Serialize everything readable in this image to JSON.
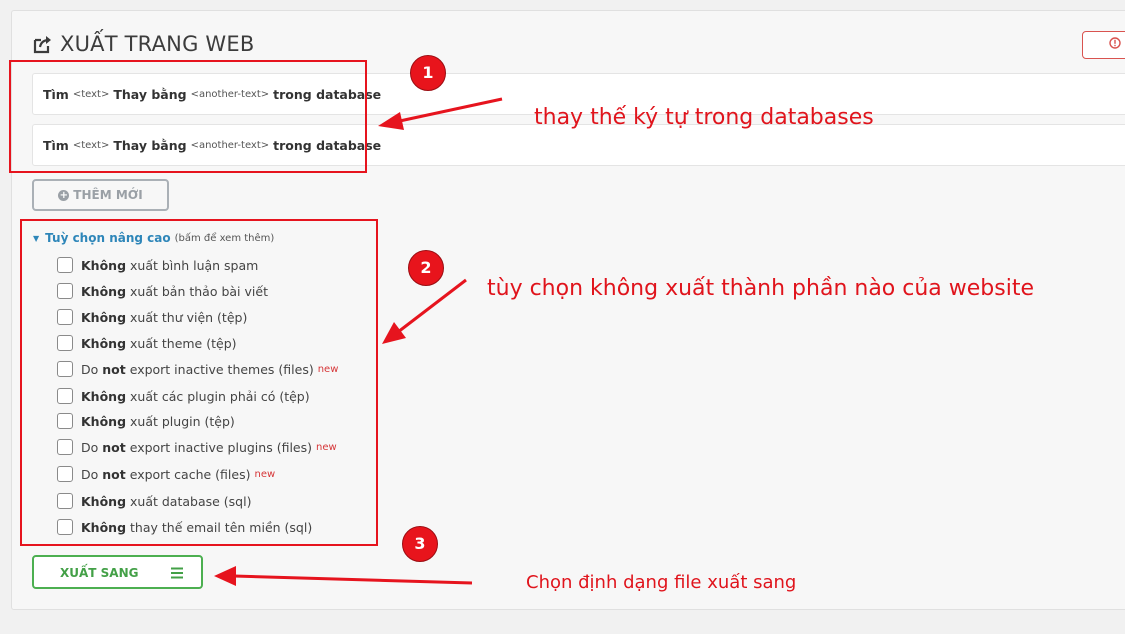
{
  "header": {
    "title": "XUẤT TRANG WEB",
    "help_icon": "info-circle-icon",
    "export_icon": "share-square-icon"
  },
  "replace_rows": [
    {
      "find": "Tìm",
      "text_placeholder": "<text>",
      "replace": "Thay bằng",
      "another_placeholder": "<another-text>",
      "suffix": "trong database"
    },
    {
      "find": "Tìm",
      "text_placeholder": "<text>",
      "replace": "Thay bằng",
      "another_placeholder": "<another-text>",
      "suffix": "trong database"
    }
  ],
  "add_button": {
    "label": "THÊM MỚI",
    "icon": "plus-circle-icon"
  },
  "advanced": {
    "label": "Tuỳ chọn nâng cao",
    "hint": "(bấm để xem thêm)",
    "options": [
      {
        "bold": "Không",
        "rest": "xuất bình luận spam",
        "new": ""
      },
      {
        "bold": "Không",
        "rest": "xuất bản thảo bài viết",
        "new": ""
      },
      {
        "bold": "Không",
        "rest": "xuất thư viện (tệp)",
        "new": ""
      },
      {
        "bold": "Không",
        "rest": "xuất theme (tệp)",
        "new": ""
      },
      {
        "pre": "Do",
        "bold": "not",
        "rest": "export inactive themes (files)",
        "new": "new"
      },
      {
        "bold": "Không",
        "rest": "xuất các plugin phải có (tệp)",
        "new": ""
      },
      {
        "bold": "Không",
        "rest": "xuất plugin (tệp)",
        "new": ""
      },
      {
        "pre": "Do",
        "bold": "not",
        "rest": "export inactive plugins (files)",
        "new": "new"
      },
      {
        "pre": "Do",
        "bold": "not",
        "rest": "export cache (files)",
        "new": "new"
      },
      {
        "bold": "Không",
        "rest": "xuất database (sql)",
        "new": ""
      },
      {
        "bold": "Không",
        "rest": "thay thế email tên miền (sql)",
        "new": ""
      }
    ]
  },
  "export_button": {
    "label": "XUẤT SANG",
    "icon": "hamburger-menu-icon"
  },
  "annotations": {
    "badges": [
      "1",
      "2",
      "3"
    ],
    "notes": [
      "thay thế ký tự trong databases",
      "tùy chọn không xuất thành phần nào của website",
      "Chọn định dạng file xuất sang"
    ],
    "color": "#e6141e"
  }
}
